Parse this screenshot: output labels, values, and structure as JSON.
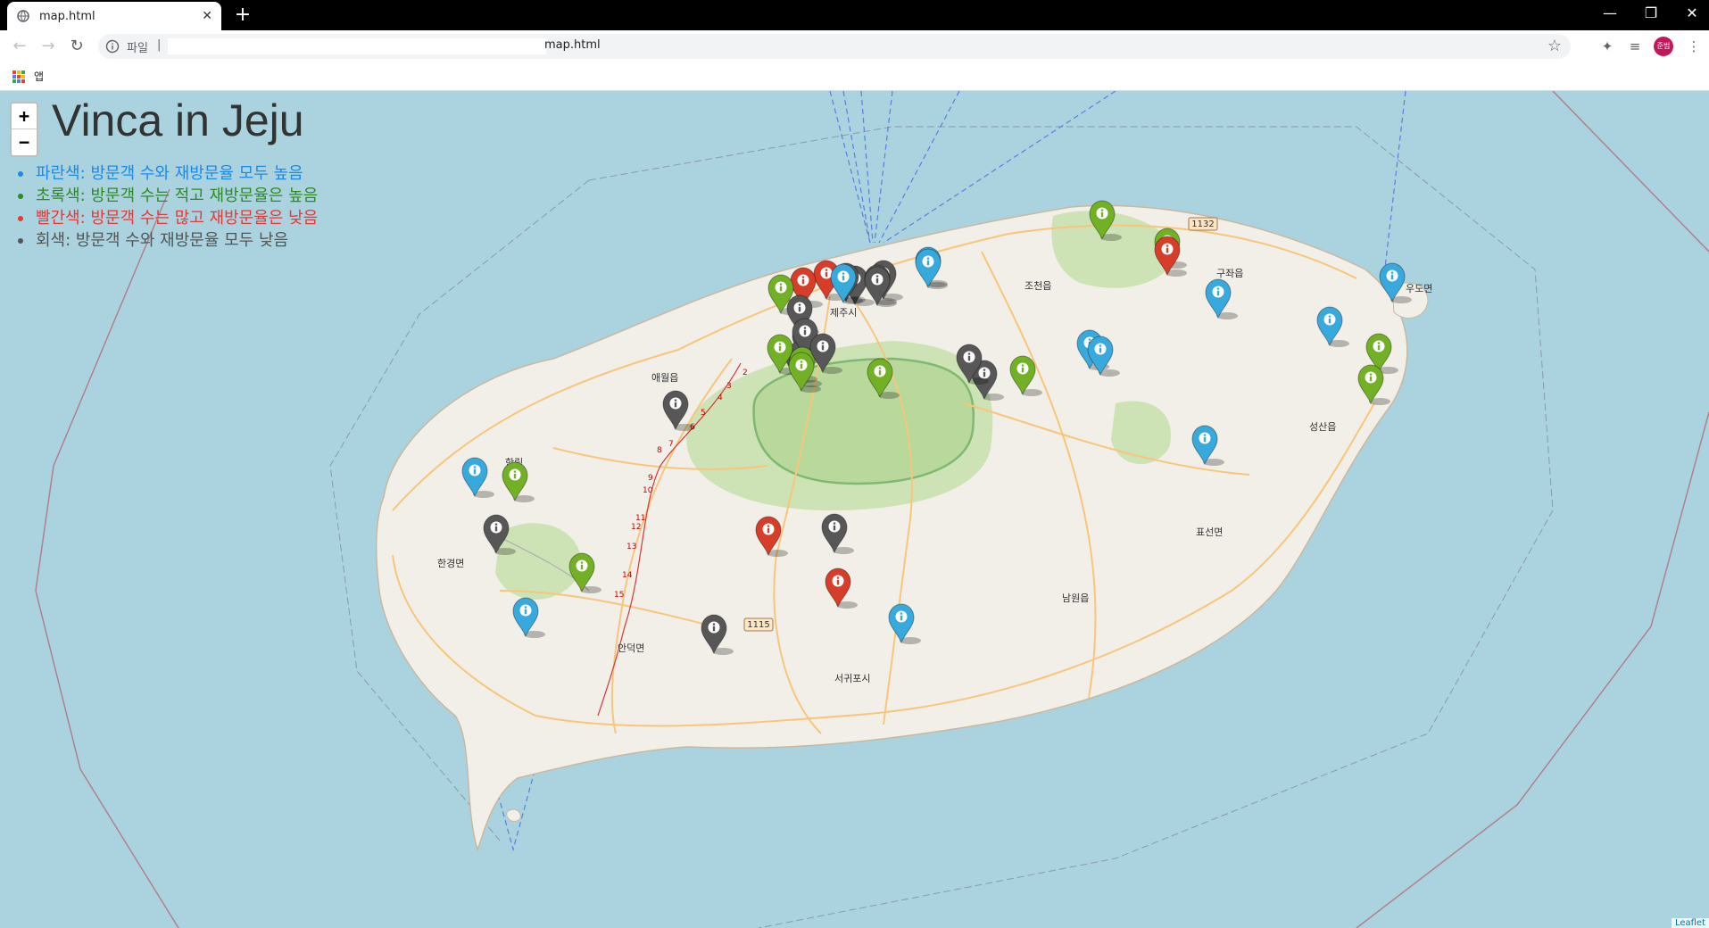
{
  "browser": {
    "tab_title": "map.html",
    "address_scheme": "파일",
    "address_separator": "|",
    "address_url": "map.html",
    "profile_initials": "준범",
    "bookmarks_apps_label": "앱"
  },
  "map": {
    "title": "Vinca in Jeju",
    "zoom_in_label": "+",
    "zoom_out_label": "−",
    "attribution": "Leaflet",
    "legend": [
      {
        "label": "파란색: 방문객 수와 재방문율 모두 높음",
        "color": "#1e88e5"
      },
      {
        "label": "초록색: 방문객 수는 적고 재방문율은 높음",
        "color": "#2e8b1f"
      },
      {
        "label": "빨간색: 방문객 수는 많고 재방문율은 낮음",
        "color": "#e53935"
      },
      {
        "label": "회색: 방문객 수와 재방문율 모두 낮음",
        "color": "#555555"
      }
    ],
    "marker_colors": {
      "blue": "#38a9dc",
      "green": "#72b026",
      "red": "#d63e2a",
      "gray": "#575757"
    },
    "place_names": [
      "제주시",
      "서귀포시",
      "애월읍",
      "조천읍",
      "구좌읍",
      "우도면",
      "성산읍",
      "표선면",
      "남원읍",
      "안덕면",
      "한경면",
      "한림"
    ],
    "road_numbers": [
      "1132",
      "1115"
    ],
    "markers": [
      {
        "color": "green"
      },
      {
        "color": "green"
      },
      {
        "color": "red"
      },
      {
        "color": "red"
      },
      {
        "color": "green"
      },
      {
        "color": "red"
      },
      {
        "color": "gray"
      },
      {
        "color": "blue"
      },
      {
        "color": "gray"
      },
      {
        "color": "gray"
      },
      {
        "color": "gray"
      },
      {
        "color": "blue"
      },
      {
        "color": "gray"
      },
      {
        "color": "gray"
      },
      {
        "color": "gray"
      },
      {
        "color": "gray"
      },
      {
        "color": "green"
      },
      {
        "color": "gray"
      },
      {
        "color": "green"
      },
      {
        "color": "gray"
      },
      {
        "color": "green"
      },
      {
        "color": "green"
      },
      {
        "color": "blue"
      },
      {
        "color": "blue"
      },
      {
        "color": "blue"
      },
      {
        "color": "blue"
      },
      {
        "color": "blue"
      },
      {
        "color": "blue"
      },
      {
        "color": "blue"
      },
      {
        "color": "green"
      },
      {
        "color": "green"
      },
      {
        "color": "gray"
      },
      {
        "color": "blue"
      },
      {
        "color": "green"
      },
      {
        "color": "green"
      },
      {
        "color": "gray"
      },
      {
        "color": "gray"
      },
      {
        "color": "gray"
      },
      {
        "color": "gray"
      },
      {
        "color": "red"
      },
      {
        "color": "green"
      },
      {
        "color": "blue"
      },
      {
        "color": "red"
      },
      {
        "color": "blue"
      },
      {
        "color": "gray"
      }
    ]
  }
}
